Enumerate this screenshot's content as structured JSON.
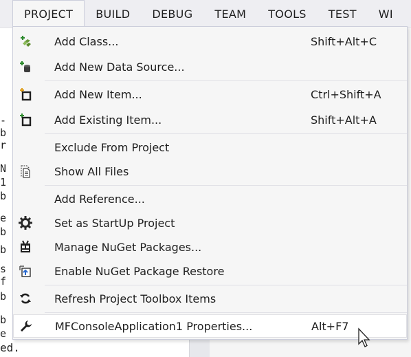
{
  "menubar": {
    "items": [
      {
        "label": "PROJECT"
      },
      {
        "label": "BUILD"
      },
      {
        "label": "DEBUG"
      },
      {
        "label": "TEAM"
      },
      {
        "label": "TOOLS"
      },
      {
        "label": "TEST"
      },
      {
        "label": "WI"
      }
    ]
  },
  "background": {
    "code_chars": [
      "-",
      "b",
      "r",
      "N",
      "1",
      "b",
      "e",
      "b",
      "b",
      "s",
      "f",
      "b",
      "b",
      "e"
    ],
    "code_last_line": "ed."
  },
  "menu": {
    "items": [
      {
        "label": "Add Class...",
        "shortcut": "Shift+Alt+C",
        "icon": "add-class-icon"
      },
      {
        "label": "Add New Data Source...",
        "shortcut": "",
        "icon": "add-data-source-icon"
      },
      {
        "label": "Add New Item...",
        "shortcut": "Ctrl+Shift+A",
        "icon": "add-new-item-icon"
      },
      {
        "label": "Add Existing Item...",
        "shortcut": "Shift+Alt+A",
        "icon": "add-existing-item-icon"
      },
      {
        "label": "Exclude From Project",
        "shortcut": "",
        "icon": ""
      },
      {
        "label": "Show All Files",
        "shortcut": "",
        "icon": "show-all-files-icon"
      },
      {
        "label": "Add Reference...",
        "shortcut": "",
        "icon": ""
      },
      {
        "label": "Set as StartUp Project",
        "shortcut": "",
        "icon": "gear-icon"
      },
      {
        "label": "Manage NuGet Packages...",
        "shortcut": "",
        "icon": "nuget-icon"
      },
      {
        "label": "Enable NuGet Package Restore",
        "shortcut": "",
        "icon": "package-restore-icon"
      },
      {
        "label": "Refresh Project Toolbox Items",
        "shortcut": "",
        "icon": "refresh-icon"
      },
      {
        "label": "MFConsoleApplication1 Properties...",
        "shortcut": "Alt+F7",
        "icon": "wrench-icon"
      }
    ]
  }
}
